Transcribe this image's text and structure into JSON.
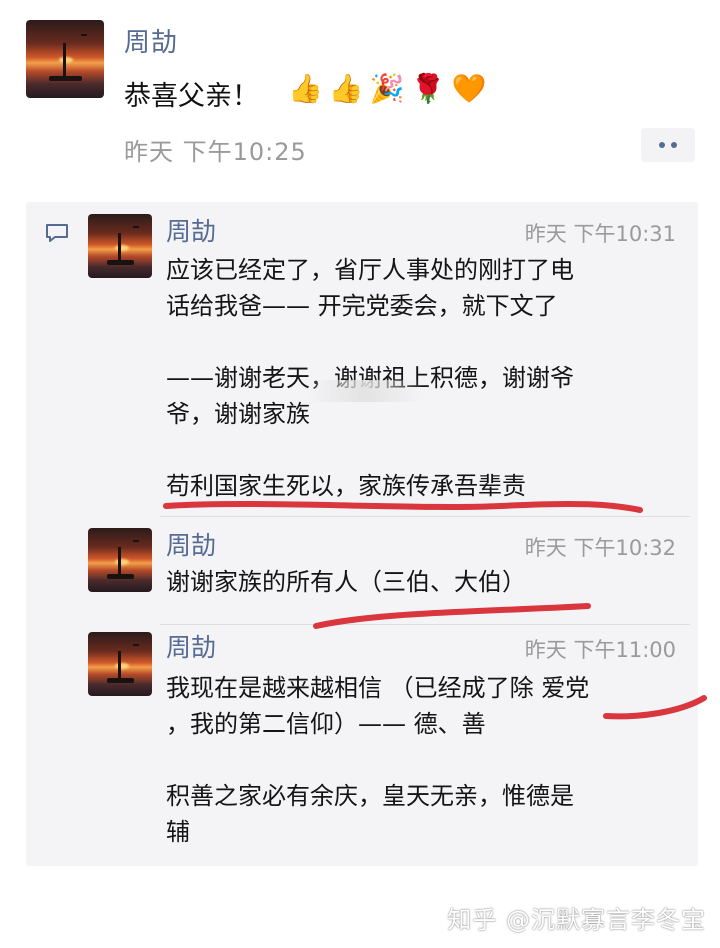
{
  "post": {
    "author": "周劼",
    "text": "恭喜父亲！",
    "emojis": [
      "👍",
      "👍",
      "🎉",
      "🌹",
      "🧡"
    ],
    "time": "昨天 下午10:25"
  },
  "comments": [
    {
      "author": "周劼",
      "time": "昨天 下午10:31",
      "text": "应该已经定了，省厅人事处的刚打了电\n话给我爸—— 开完党委会，就下文了\n\n——谢谢老天，谢谢祖上积德，谢谢爷\n爷，谢谢家族\n\n苟利国家生死以，家族传承吾辈责"
    },
    {
      "author": "周劼",
      "time": "昨天 下午10:32",
      "text": "谢谢家族的所有人（三伯、大伯）"
    },
    {
      "author": "周劼",
      "time": "昨天 下午11:00",
      "text": "我现在是越来越相信 （已经成了除 爱党\n，我的第二信仰）—— 德、善\n\n积善之家必有余庆，皇天无亲，惟德是\n辅"
    }
  ],
  "footer": {
    "watermark": "知乎 @沉默寡言李冬宝"
  },
  "colors": {
    "name": "#566b94",
    "time": "#9a9a9a",
    "comment_bg": "#f4f4f6",
    "underline": "#d9363e"
  }
}
